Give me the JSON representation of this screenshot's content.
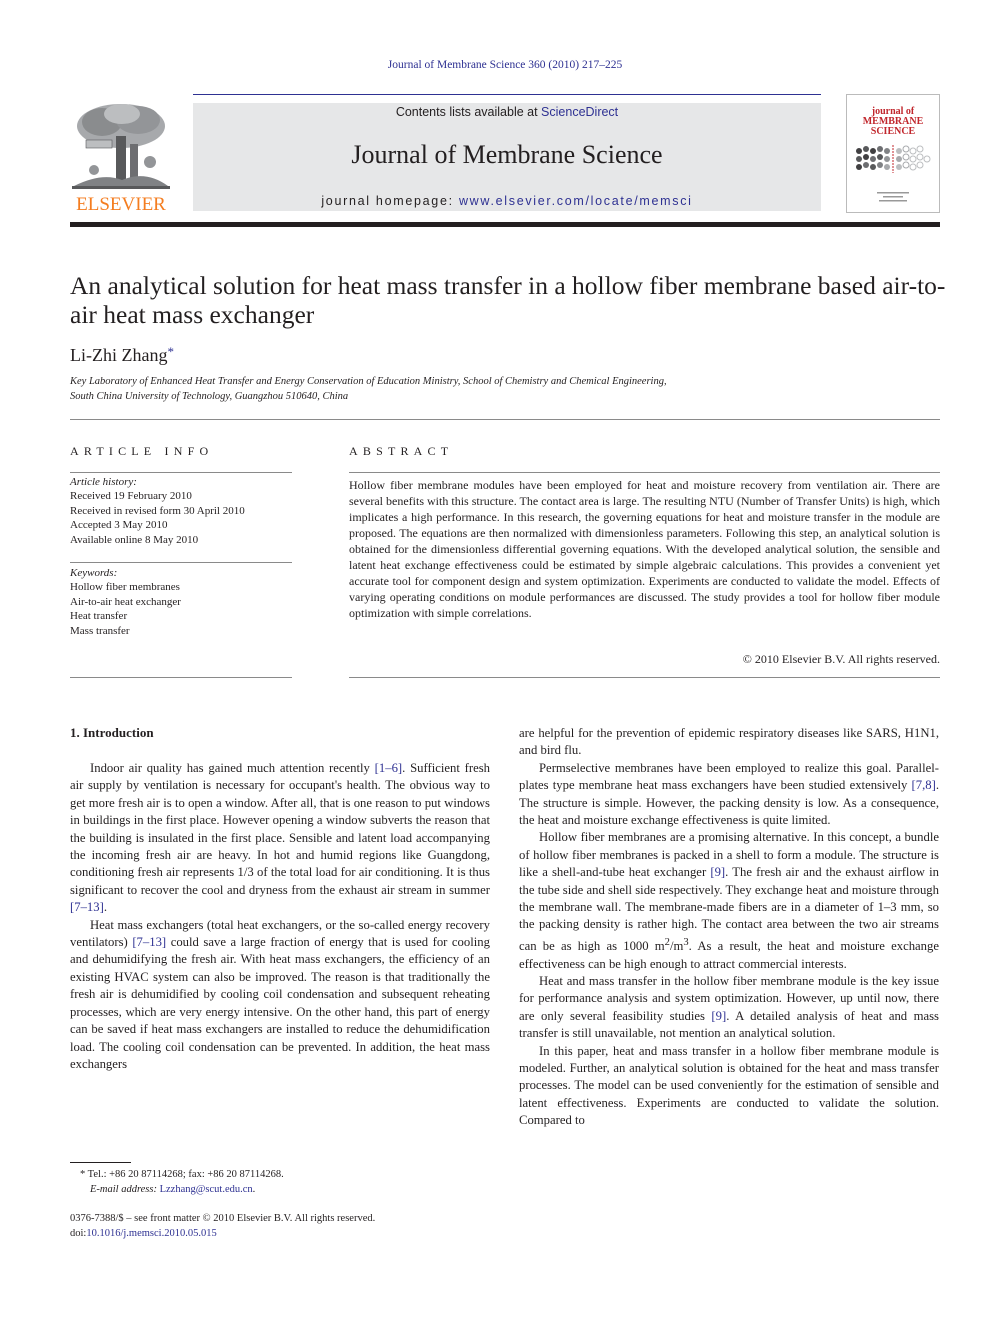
{
  "header": {
    "journal_reference": "Journal of Membrane Science 360 (2010) 217–225",
    "contents_prefix": "Contents lists available at ",
    "contents_link": "ScienceDirect",
    "journal_name": "Journal of Membrane Science",
    "homepage_prefix": "journal homepage: ",
    "homepage_link": "www.elsevier.com/locate/memsci",
    "publisher_logo_text": "ELSEVIER",
    "cover": {
      "title_line1": "journal of",
      "title_line2": "MEMBRANE",
      "title_line3": "SCIENCE"
    }
  },
  "article": {
    "title": "An analytical solution for heat mass transfer in a hollow fiber membrane based air-to-air heat mass exchanger",
    "author": "Li-Zhi Zhang",
    "author_mark": "*",
    "affiliation_line1": "Key Laboratory of Enhanced Heat Transfer and Energy Conservation of Education Ministry, School of Chemistry and Chemical Engineering,",
    "affiliation_line2": "South China University of Technology, Guangzhou 510640, China"
  },
  "article_info": {
    "heading": "ARTICLE INFO",
    "history_label": "Article history:",
    "history": [
      "Received 19 February 2010",
      "Received in revised form 30 April 2010",
      "Accepted 3 May 2010",
      "Available online 8 May 2010"
    ],
    "keywords_label": "Keywords:",
    "keywords": [
      "Hollow fiber membranes",
      "Air-to-air heat exchanger",
      "Heat transfer",
      "Mass transfer"
    ]
  },
  "abstract": {
    "heading": "ABSTRACT",
    "text": "Hollow fiber membrane modules have been employed for heat and moisture recovery from ventilation air. There are several benefits with this structure. The contact area is large. The resulting NTU (Number of Transfer Units) is high, which implicates a high performance. In this research, the governing equations for heat and moisture transfer in the module are proposed. The equations are then normalized with dimensionless parameters. Following this step, an analytical solution is obtained for the dimensionless differential governing equations. With the developed analytical solution, the sensible and latent heat exchange effectiveness could be estimated by simple algebraic calculations. This provides a convenient yet accurate tool for component design and system optimization. Experiments are conducted to validate the model. Effects of varying operating conditions on module performances are discussed. The study provides a tool for hollow fiber module optimization with simple correlations.",
    "copyright": "© 2010 Elsevier B.V. All rights reserved."
  },
  "body": {
    "section_heading": "1.  Introduction",
    "left_col": {
      "p1_a": "Indoor air quality has gained much attention recently ",
      "p1_ref1": "[1–6]",
      "p1_b": ". Sufficient fresh air supply by ventilation is necessary for occupant's health. The obvious way to get more fresh air is to open a window. After all, that is one reason to put windows in buildings in the first place. However opening a window subverts the reason that the building is insulated in the first place. Sensible and latent load accompanying the incoming fresh air are heavy. In hot and humid regions like Guangdong, conditioning fresh air represents 1/3 of the total load for air conditioning. It is thus significant to recover the cool and dryness from the exhaust air stream in summer ",
      "p1_ref2": "[7–13]",
      "p1_c": ".",
      "p2_a": "Heat mass exchangers (total heat exchangers, or the so-called energy recovery ventilators) ",
      "p2_ref1": "[7–13]",
      "p2_b": " could save a large fraction of energy that is used for cooling and dehumidifying the fresh air. With heat mass exchangers, the efficiency of an existing HVAC system can also be improved. The reason is that traditionally the fresh air is dehumidified by cooling coil condensation and subsequent reheating processes, which are very energy intensive. On the other hand, this part of energy can be saved if heat mass exchangers are installed to reduce the dehumidification load. The cooling coil condensation can be prevented. In addition, the heat mass exchangers"
    },
    "right_col": {
      "p0": "are helpful for the prevention of epidemic respiratory diseases like SARS, H1N1, and bird flu.",
      "p1_a": "Permselective membranes have been employed to realize this goal. Parallel-plates type membrane heat mass exchangers have been studied extensively ",
      "p1_ref": "[7,8]",
      "p1_b": ". The structure is simple. However, the packing density is low. As a consequence, the heat and moisture exchange effectiveness is quite limited.",
      "p2_a": "Hollow fiber membranes are a promising alternative. In this concept, a bundle of hollow fiber membranes is packed in a shell to form a module. The structure is like a shell-and-tube heat exchanger ",
      "p2_ref": "[9]",
      "p2_b": ". The fresh air and the exhaust airflow in the tube side and shell side respectively. They exchange heat and moisture through the membrane wall. The membrane-made fibers are in a diameter of 1–3 mm, so the packing density is rather high. The contact area between the two air streams can be as high as 1000 m",
      "p2_sup1": "2",
      "p2_mid": "/m",
      "p2_sup2": "3",
      "p2_c": ". As a result, the heat and moisture exchange effectiveness can be high enough to attract commercial interests.",
      "p3_a": "Heat and mass transfer in the hollow fiber membrane module is the key issue for performance analysis and system optimization. However, up until now, there are only several feasibility studies ",
      "p3_ref": "[9]",
      "p3_b": ". A detailed analysis of heat and mass transfer is still unavailable, not mention an analytical solution.",
      "p4": "In this paper, heat and mass transfer in a hollow fiber membrane module is modeled. Further, an analytical solution is obtained for the heat and mass transfer processes. The model can be used conveniently for the estimation of sensible and latent effectiveness. Experiments are conducted to validate the solution. Compared to"
    }
  },
  "footnote": {
    "mark": "*",
    "contact": " Tel.: +86 20 87114268; fax: +86 20 87114268.",
    "email_label": "E-mail address: ",
    "email": "Lzzhang@scut.edu.cn",
    "email_suffix": "."
  },
  "front_matter": {
    "issn_line": "0376-7388/$ – see front matter © 2010 Elsevier B.V. All rights reserved.",
    "doi_prefix": "doi:",
    "doi": "10.1016/j.memsci.2010.05.015"
  },
  "colors": {
    "link": "#2e3192",
    "elsevier_orange": "#f47d20",
    "masthead_gray": "#e6e7e8",
    "cover_red": "#c1272d"
  }
}
